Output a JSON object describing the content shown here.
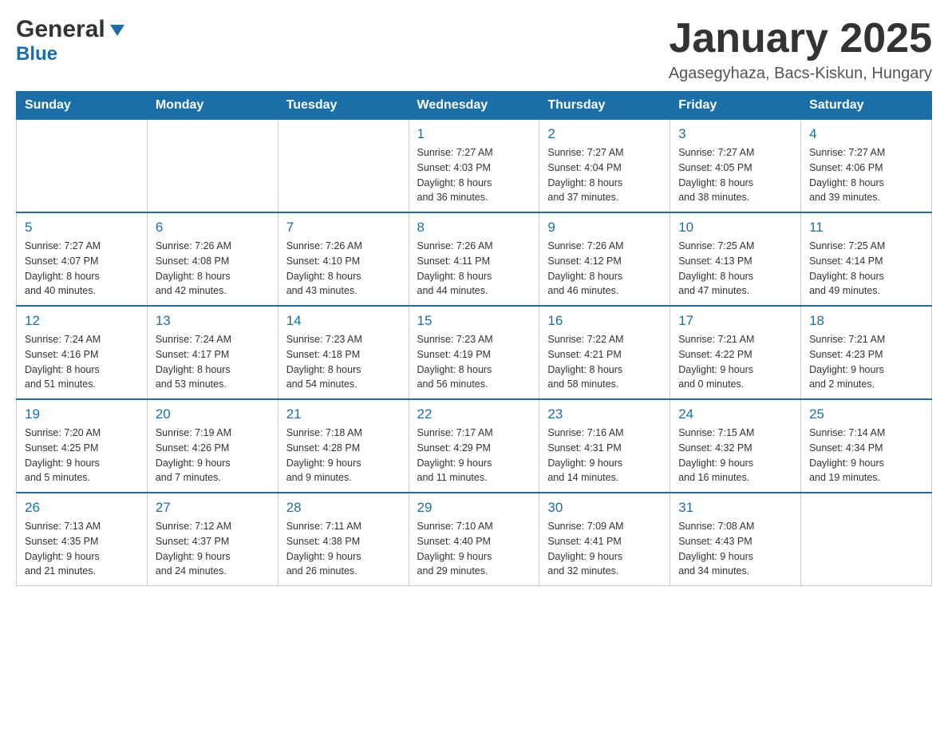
{
  "header": {
    "month_title": "January 2025",
    "location": "Agasegyhaza, Bacs-Kiskun, Hungary",
    "logo_general": "General",
    "logo_blue": "Blue"
  },
  "days_of_week": [
    "Sunday",
    "Monday",
    "Tuesday",
    "Wednesday",
    "Thursday",
    "Friday",
    "Saturday"
  ],
  "weeks": [
    [
      {
        "day": "",
        "info": ""
      },
      {
        "day": "",
        "info": ""
      },
      {
        "day": "",
        "info": ""
      },
      {
        "day": "1",
        "info": "Sunrise: 7:27 AM\nSunset: 4:03 PM\nDaylight: 8 hours\nand 36 minutes."
      },
      {
        "day": "2",
        "info": "Sunrise: 7:27 AM\nSunset: 4:04 PM\nDaylight: 8 hours\nand 37 minutes."
      },
      {
        "day": "3",
        "info": "Sunrise: 7:27 AM\nSunset: 4:05 PM\nDaylight: 8 hours\nand 38 minutes."
      },
      {
        "day": "4",
        "info": "Sunrise: 7:27 AM\nSunset: 4:06 PM\nDaylight: 8 hours\nand 39 minutes."
      }
    ],
    [
      {
        "day": "5",
        "info": "Sunrise: 7:27 AM\nSunset: 4:07 PM\nDaylight: 8 hours\nand 40 minutes."
      },
      {
        "day": "6",
        "info": "Sunrise: 7:26 AM\nSunset: 4:08 PM\nDaylight: 8 hours\nand 42 minutes."
      },
      {
        "day": "7",
        "info": "Sunrise: 7:26 AM\nSunset: 4:10 PM\nDaylight: 8 hours\nand 43 minutes."
      },
      {
        "day": "8",
        "info": "Sunrise: 7:26 AM\nSunset: 4:11 PM\nDaylight: 8 hours\nand 44 minutes."
      },
      {
        "day": "9",
        "info": "Sunrise: 7:26 AM\nSunset: 4:12 PM\nDaylight: 8 hours\nand 46 minutes."
      },
      {
        "day": "10",
        "info": "Sunrise: 7:25 AM\nSunset: 4:13 PM\nDaylight: 8 hours\nand 47 minutes."
      },
      {
        "day": "11",
        "info": "Sunrise: 7:25 AM\nSunset: 4:14 PM\nDaylight: 8 hours\nand 49 minutes."
      }
    ],
    [
      {
        "day": "12",
        "info": "Sunrise: 7:24 AM\nSunset: 4:16 PM\nDaylight: 8 hours\nand 51 minutes."
      },
      {
        "day": "13",
        "info": "Sunrise: 7:24 AM\nSunset: 4:17 PM\nDaylight: 8 hours\nand 53 minutes."
      },
      {
        "day": "14",
        "info": "Sunrise: 7:23 AM\nSunset: 4:18 PM\nDaylight: 8 hours\nand 54 minutes."
      },
      {
        "day": "15",
        "info": "Sunrise: 7:23 AM\nSunset: 4:19 PM\nDaylight: 8 hours\nand 56 minutes."
      },
      {
        "day": "16",
        "info": "Sunrise: 7:22 AM\nSunset: 4:21 PM\nDaylight: 8 hours\nand 58 minutes."
      },
      {
        "day": "17",
        "info": "Sunrise: 7:21 AM\nSunset: 4:22 PM\nDaylight: 9 hours\nand 0 minutes."
      },
      {
        "day": "18",
        "info": "Sunrise: 7:21 AM\nSunset: 4:23 PM\nDaylight: 9 hours\nand 2 minutes."
      }
    ],
    [
      {
        "day": "19",
        "info": "Sunrise: 7:20 AM\nSunset: 4:25 PM\nDaylight: 9 hours\nand 5 minutes."
      },
      {
        "day": "20",
        "info": "Sunrise: 7:19 AM\nSunset: 4:26 PM\nDaylight: 9 hours\nand 7 minutes."
      },
      {
        "day": "21",
        "info": "Sunrise: 7:18 AM\nSunset: 4:28 PM\nDaylight: 9 hours\nand 9 minutes."
      },
      {
        "day": "22",
        "info": "Sunrise: 7:17 AM\nSunset: 4:29 PM\nDaylight: 9 hours\nand 11 minutes."
      },
      {
        "day": "23",
        "info": "Sunrise: 7:16 AM\nSunset: 4:31 PM\nDaylight: 9 hours\nand 14 minutes."
      },
      {
        "day": "24",
        "info": "Sunrise: 7:15 AM\nSunset: 4:32 PM\nDaylight: 9 hours\nand 16 minutes."
      },
      {
        "day": "25",
        "info": "Sunrise: 7:14 AM\nSunset: 4:34 PM\nDaylight: 9 hours\nand 19 minutes."
      }
    ],
    [
      {
        "day": "26",
        "info": "Sunrise: 7:13 AM\nSunset: 4:35 PM\nDaylight: 9 hours\nand 21 minutes."
      },
      {
        "day": "27",
        "info": "Sunrise: 7:12 AM\nSunset: 4:37 PM\nDaylight: 9 hours\nand 24 minutes."
      },
      {
        "day": "28",
        "info": "Sunrise: 7:11 AM\nSunset: 4:38 PM\nDaylight: 9 hours\nand 26 minutes."
      },
      {
        "day": "29",
        "info": "Sunrise: 7:10 AM\nSunset: 4:40 PM\nDaylight: 9 hours\nand 29 minutes."
      },
      {
        "day": "30",
        "info": "Sunrise: 7:09 AM\nSunset: 4:41 PM\nDaylight: 9 hours\nand 32 minutes."
      },
      {
        "day": "31",
        "info": "Sunrise: 7:08 AM\nSunset: 4:43 PM\nDaylight: 9 hours\nand 34 minutes."
      },
      {
        "day": "",
        "info": ""
      }
    ]
  ]
}
